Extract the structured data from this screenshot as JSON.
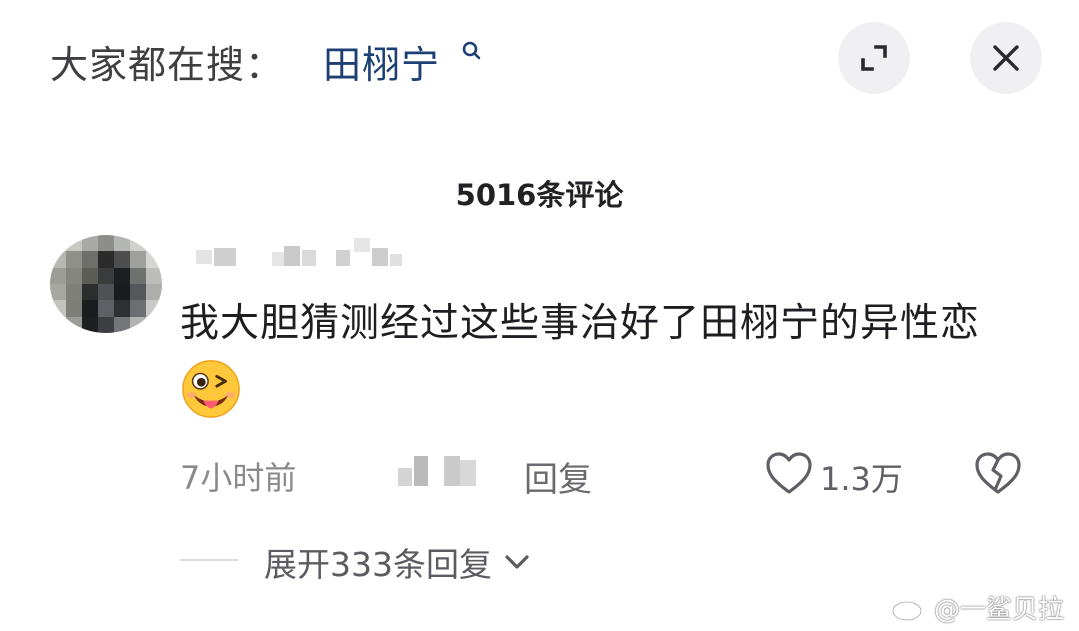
{
  "header": {
    "search_label": "大家都在搜：",
    "search_term": "田栩宁",
    "search_icon": "search-icon",
    "expand_icon": "expand-icon",
    "close_icon": "close-icon"
  },
  "comments": {
    "count_label": "5016条评论",
    "item": {
      "text": "我大胆猜测经过这些事治好了田栩宁的异性恋",
      "emoji": "wink-tongue-emoji",
      "time": "7小时前",
      "reply_label": "回复",
      "like_count": "1.3万",
      "expand_replies_label": "展开333条回复"
    }
  },
  "watermark": {
    "text": "@一鲨贝拉",
    "icon": "weibo-icon"
  },
  "colors": {
    "search_term": "#1d3f73",
    "text_primary": "#1e1e22",
    "text_secondary": "#8a8a8f",
    "button_bg": "#f0f0f2"
  }
}
